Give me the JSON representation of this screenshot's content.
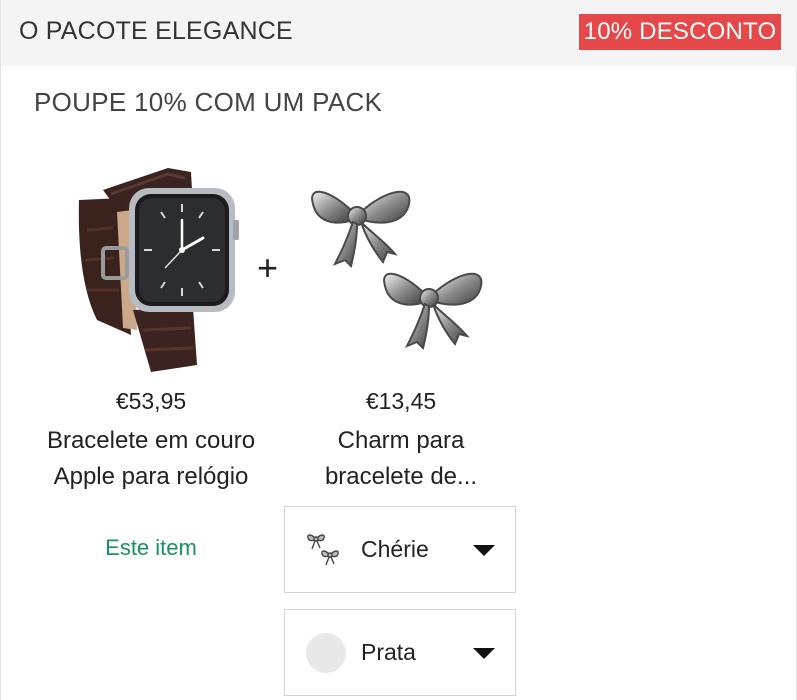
{
  "header": {
    "title": "O PACOTE ELEGANCE",
    "badge": "10% DESCONTO",
    "badge_color": "#e54848"
  },
  "bundle": {
    "subtitle": "POUPE 10% COM UM PACK",
    "plus": "+",
    "products": [
      {
        "price": "€53,95",
        "name_line1": "Bracelete em couro",
        "name_line2": "Apple para relógio",
        "image_icon": "watch-image",
        "note": "Este item",
        "note_color": "#1a9162"
      },
      {
        "price": "€13,45",
        "name_line1": "Charm para",
        "name_line2": "bracelete de...",
        "image_icon": "bow-charm-image"
      }
    ],
    "selects": {
      "style": {
        "value": "Chérie",
        "icon": "bow-icon"
      },
      "color": {
        "value": "Prata",
        "icon": "silver-swatch",
        "swatch_color": "#e8e8e8"
      }
    }
  }
}
